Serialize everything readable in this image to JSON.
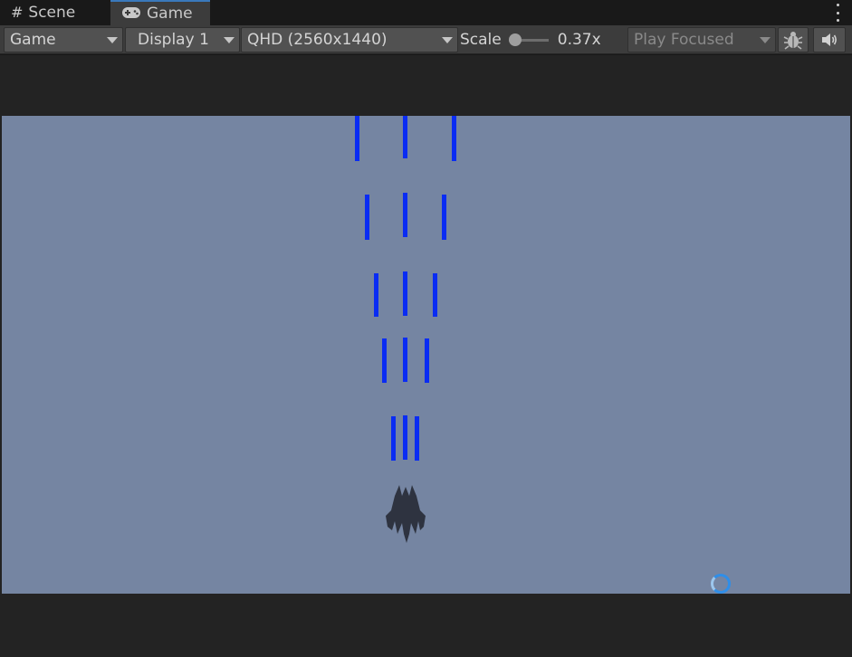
{
  "tabs": [
    {
      "label": "Scene",
      "icon": "grid-hash-icon",
      "active": false
    },
    {
      "label": "Game",
      "icon": "gamepad-icon",
      "active": true
    }
  ],
  "toolbar": {
    "view_mode": "Game",
    "display": "Display 1",
    "resolution": "QHD (2560x1440)",
    "scale_label": "Scale",
    "scale_value": "0.37x",
    "play_mode": "Play Focused",
    "stats_icon": "bug-icon",
    "audio_icon": "speaker-icon"
  },
  "game": {
    "background_color": "#7585a2",
    "bullet_color": "#0a2cf3",
    "ship_color": "#2e3340",
    "spinner_color": "#2f8ee8"
  }
}
